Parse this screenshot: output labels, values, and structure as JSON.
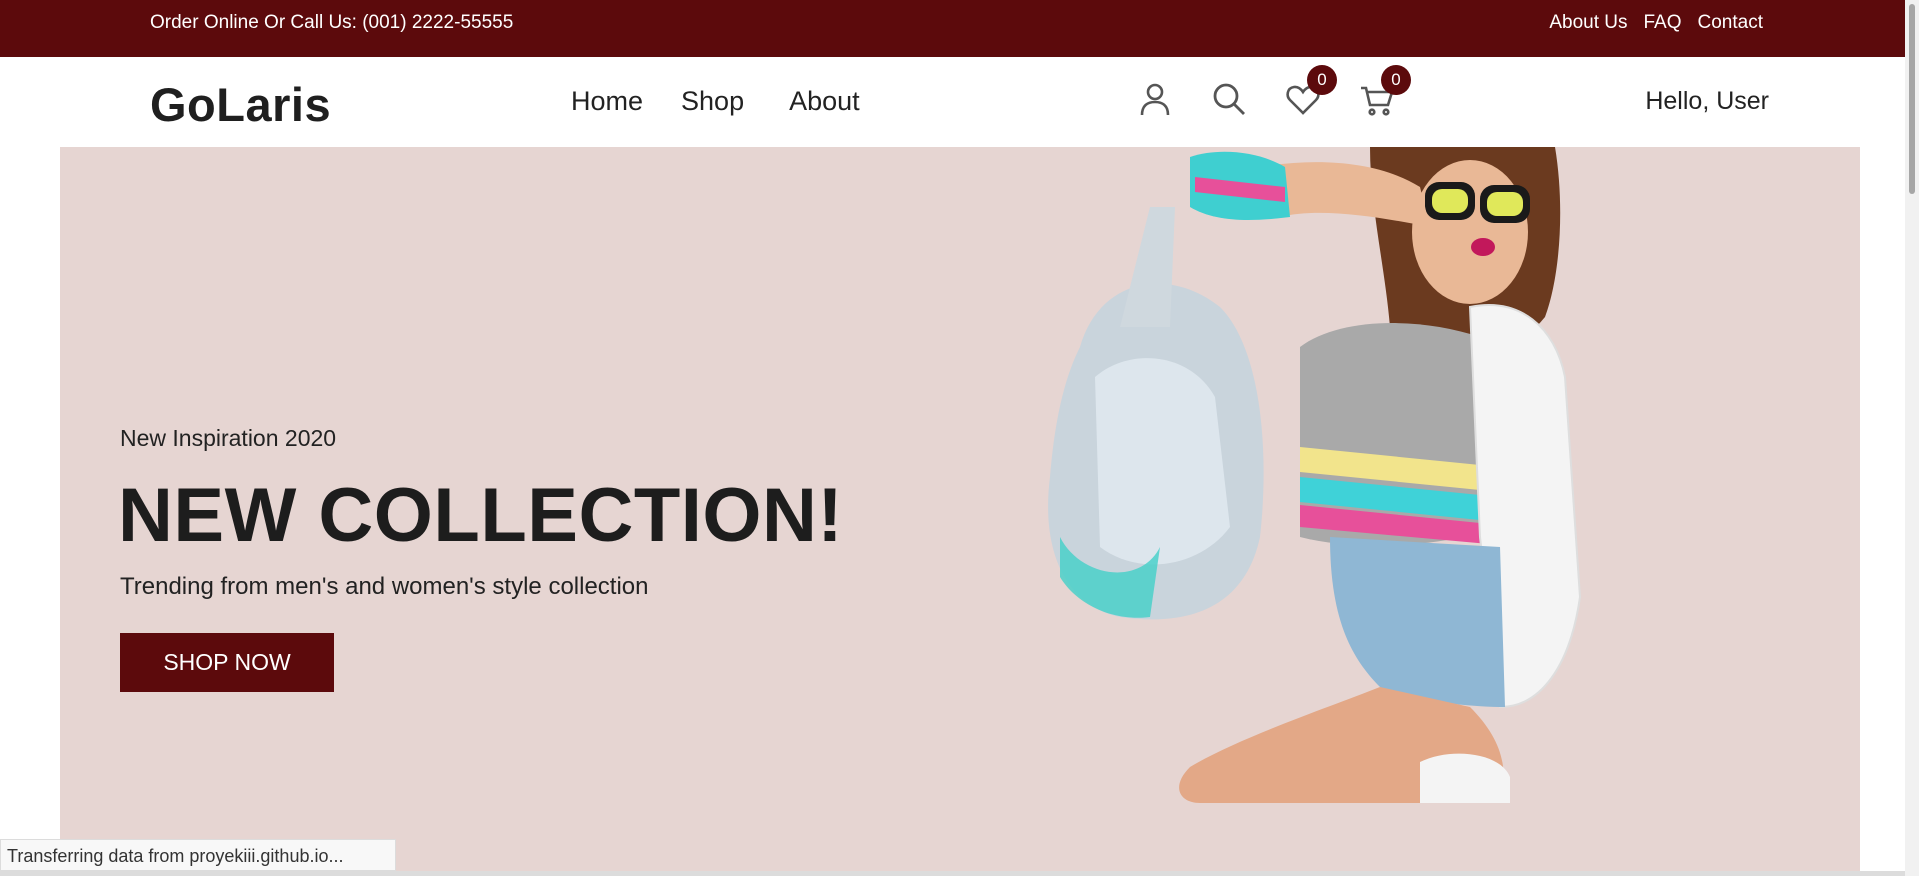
{
  "topbar": {
    "phone": "Order Online Or Call Us: (001) 2222-55555",
    "links": [
      "About Us",
      "FAQ",
      "Contact"
    ]
  },
  "header": {
    "logo": "GoLaris",
    "nav": [
      "Home",
      "Shop",
      "About"
    ],
    "icons": [
      "user-icon",
      "search-icon",
      "heart-icon",
      "cart-icon"
    ],
    "wishlist_count": "0",
    "cart_count": "0",
    "greeting": "Hello, User"
  },
  "hero": {
    "subtitle": "New Inspiration 2020",
    "title": "NEW COLLECTION!",
    "description": "Trending from men's and women's style collection",
    "button": "SHOP NOW"
  },
  "status": {
    "text": "Transferring data from proyekiii.github.io..."
  },
  "colors": {
    "brand": "#5c0a0c",
    "hero_bg": "#e6d5d2"
  }
}
